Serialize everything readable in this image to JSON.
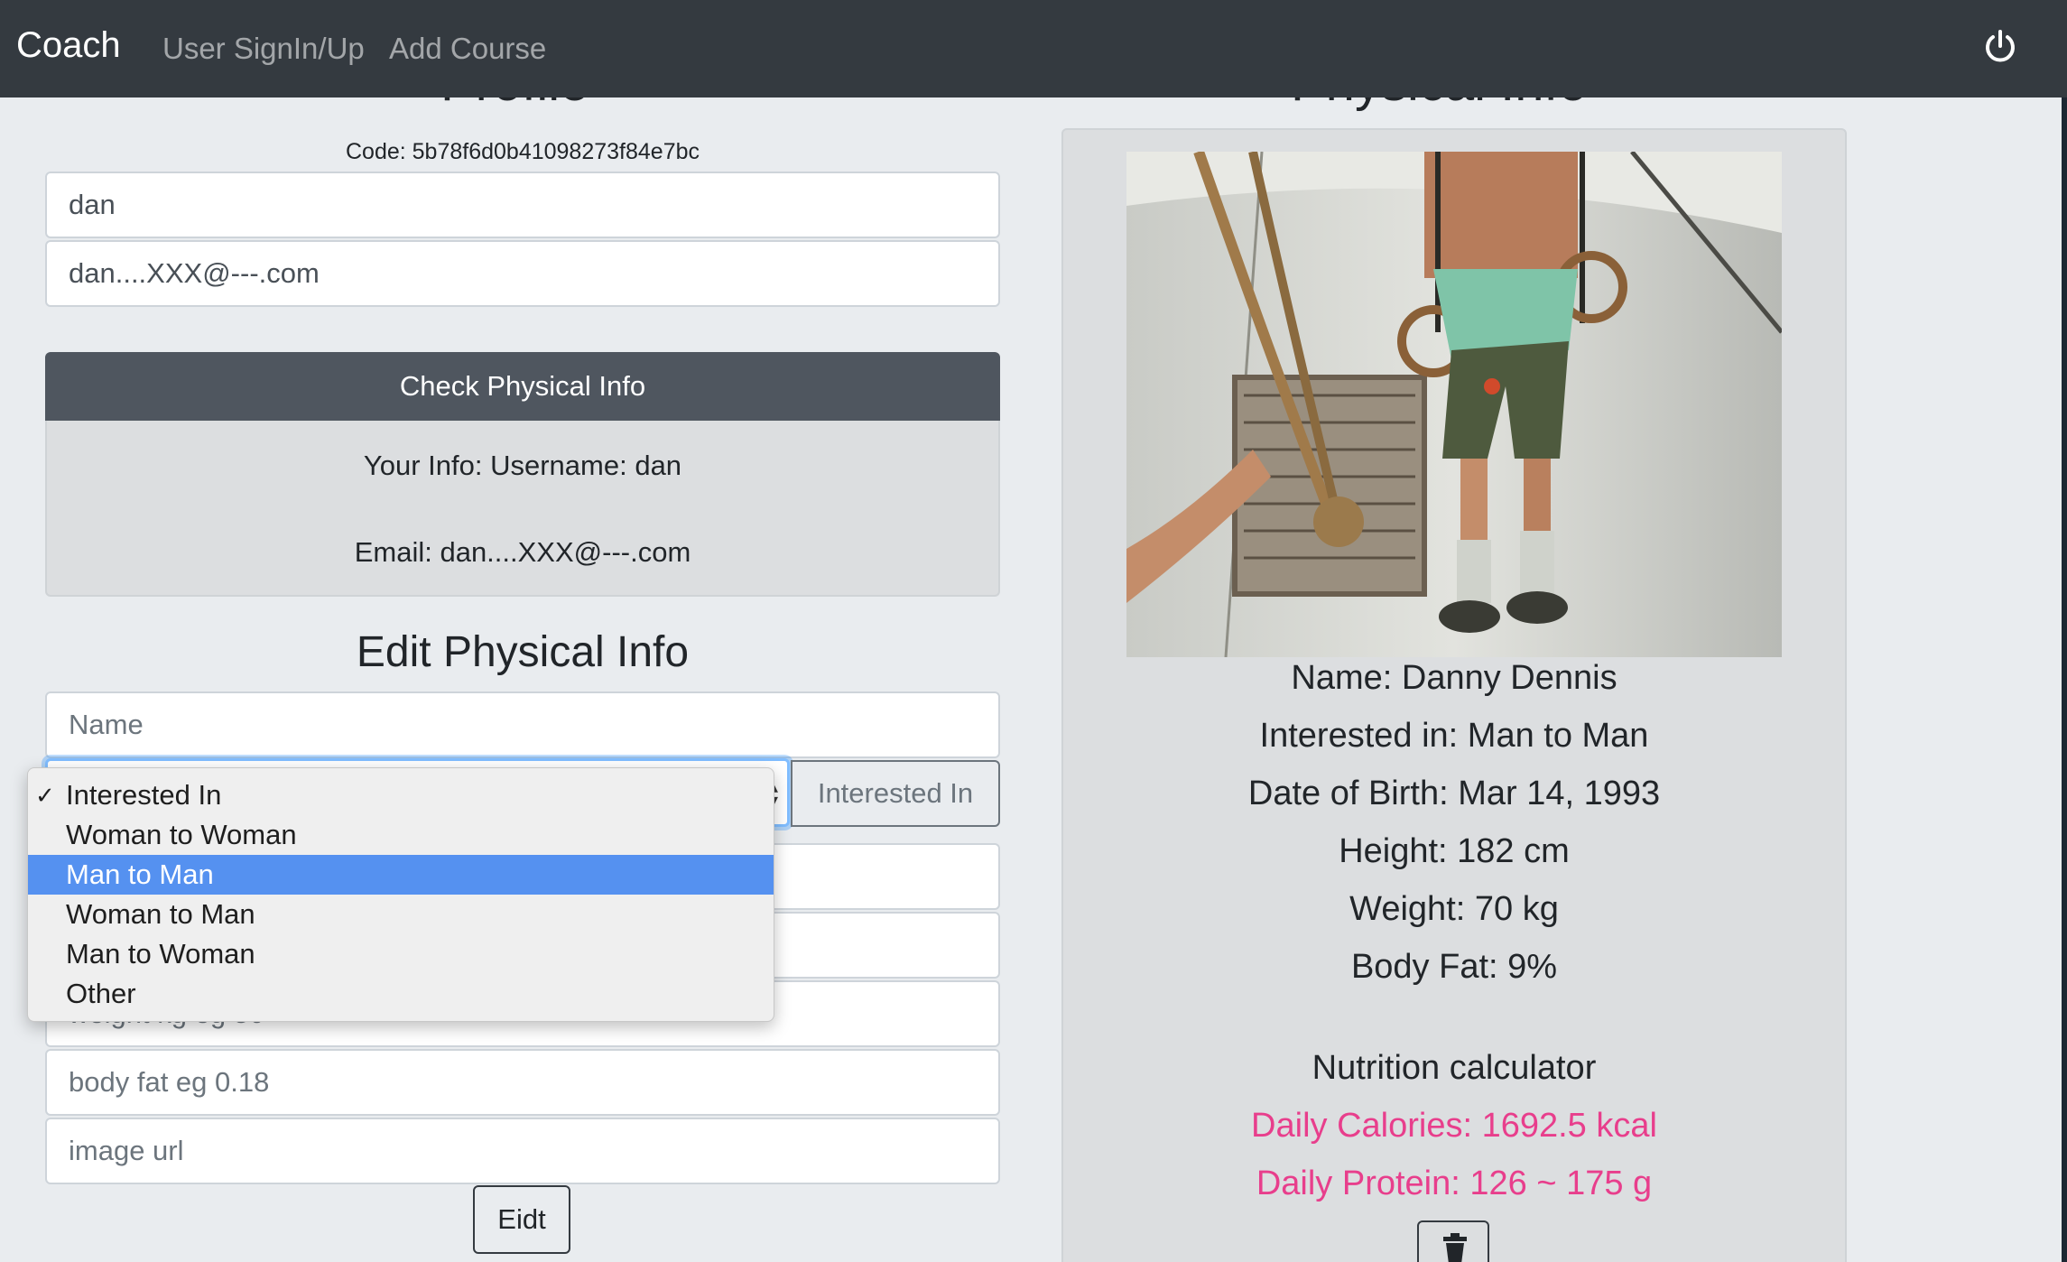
{
  "navbar": {
    "brand": "Coach",
    "links": [
      "User SignIn/Up",
      "Add Course"
    ],
    "power_icon": "power-icon"
  },
  "left": {
    "heading": "Profile",
    "code": "Code: 5b78f6d0b41098273f84e7bc",
    "username_value": "dan",
    "email_value": "dan....XXX@---.com",
    "check_button": "Check Physical Info",
    "info_username": "Your Info: Username: dan",
    "info_email": "Email: dan....XXX@---.com",
    "edit_title": "Edit Physical Info",
    "name_placeholder": "Name",
    "interested_append": "Interested In",
    "select_options": [
      "Interested In",
      "Woman to Woman",
      "Man to Man",
      "Woman to Man",
      "Man to Woman",
      "Other"
    ],
    "select_checked": "Interested In",
    "select_highlighted": "Man to Man",
    "weight_placeholder_partial": "weight kg eg 50",
    "bodyfat_placeholder": "body fat  eg 0.18",
    "image_placeholder": "image url",
    "edit_button": "Eidt"
  },
  "right": {
    "heading": "Physical Info",
    "name": "Name: Danny Dennis",
    "interested": "Interested in: Man to Man",
    "dob": "Date of Birth: Mar 14, 1993",
    "height": "Height: 182 cm",
    "weight": "Weight: 70 kg",
    "bodyfat": "Body Fat: 9%",
    "nutrition_title": "Nutrition calculator",
    "calories": "Daily Calories: 1692.5 kcal",
    "protein": "Daily Protein: 126 ~ 175 g",
    "delete_icon": "trash-icon"
  },
  "colors": {
    "navbar": "#343a40",
    "accent_pink": "#e83e8c",
    "select_highlight": "#5591f0"
  }
}
